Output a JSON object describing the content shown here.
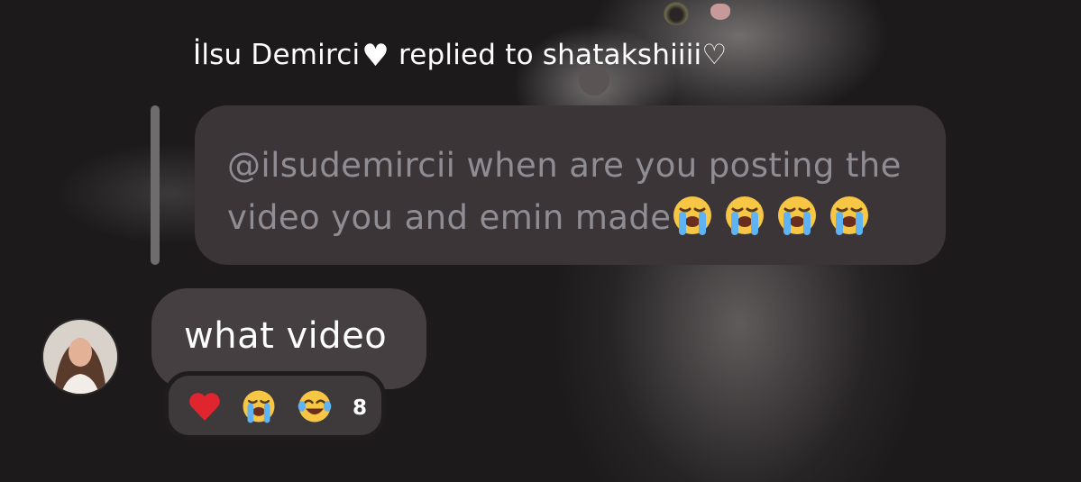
{
  "reply_header": {
    "sender": "İlsu Demirci",
    "sender_suffix_icon": "white-heart-icon",
    "action_text": "replied to shatakshiiii♡"
  },
  "quoted_message": {
    "mention": "@ilsudemircii",
    "text": "when are you posting the video you and emin made",
    "emojis": [
      "loudly-crying-face",
      "loudly-crying-face",
      "loudly-crying-face",
      "loudly-crying-face"
    ]
  },
  "message": {
    "text": "what video",
    "avatar": "avatar"
  },
  "reactions": {
    "emojis": [
      "red-heart",
      "loudly-crying-face",
      "face-with-tears-of-joy"
    ],
    "count": "8"
  },
  "colors": {
    "background": "#1c1a1b",
    "quoted_bubble": "#3b3537",
    "message_bubble": "#463f41",
    "quoted_text": "#8f8d94",
    "text": "#ffffff"
  }
}
